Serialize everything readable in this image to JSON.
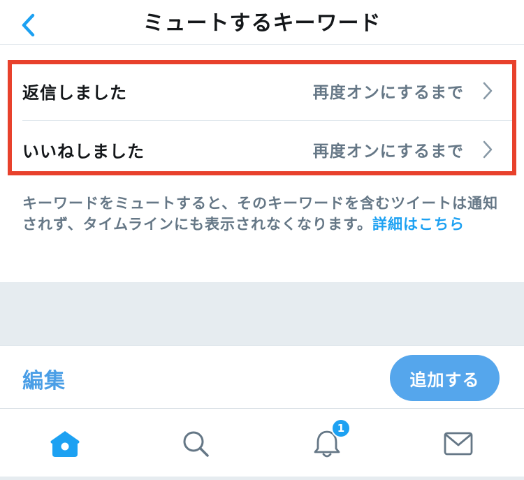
{
  "header": {
    "title": "ミュートするキーワード",
    "back_icon": "chevron-left-icon"
  },
  "keywords": [
    {
      "label": "返信しました",
      "status": "再度オンにするまで"
    },
    {
      "label": "いいねしました",
      "status": "再度オンにするまで"
    }
  ],
  "description": {
    "text": "キーワードをミュートすると、そのキーワードを含むツイートは通知されず、タイムラインにも表示されなくなります。",
    "link": "詳細はこちら"
  },
  "actions": {
    "edit_label": "編集",
    "add_label": "追加する"
  },
  "tab_bar": {
    "tabs": [
      {
        "name": "home",
        "icon": "home-icon",
        "active": true
      },
      {
        "name": "search",
        "icon": "search-icon",
        "active": false
      },
      {
        "name": "notifications",
        "icon": "bell-icon",
        "active": false,
        "badge": "1"
      },
      {
        "name": "messages",
        "icon": "envelope-icon",
        "active": false
      }
    ]
  },
  "colors": {
    "accent": "#1da1f2",
    "highlight": "#e8412c",
    "secondary_text": "#657786"
  }
}
